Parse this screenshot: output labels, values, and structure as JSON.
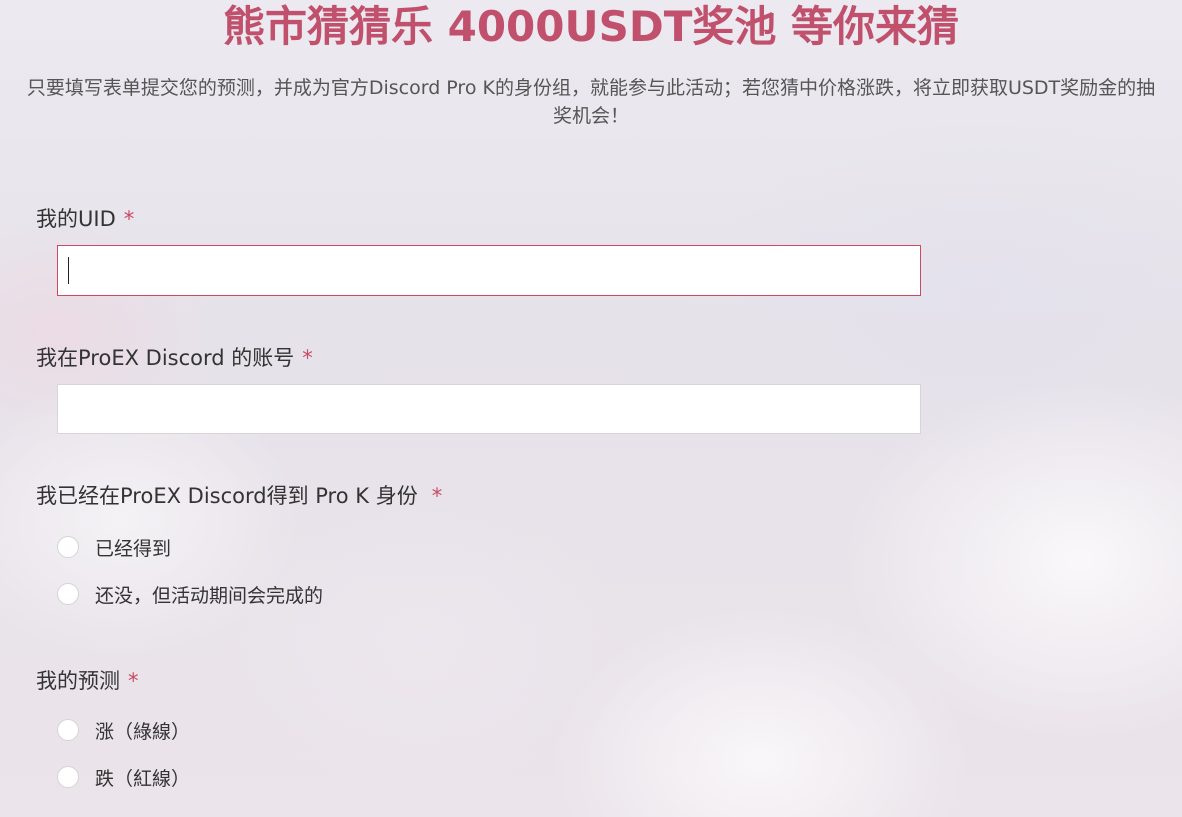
{
  "header": {
    "title": "熊市猜猜乐 4000USDT奖池 等你来猜",
    "subtitle": "只要填写表单提交您的预测，并成为官方Discord Pro K的身份组，就能参与此活动；若您猜中价格涨跌，将立即获取USDT奖励金的抽奖机会！"
  },
  "colors": {
    "accent": "#c0506c",
    "required": "#c94a62"
  },
  "form": {
    "uid": {
      "label": "我的UID",
      "required_mark": "*",
      "value": ""
    },
    "discord_account": {
      "label": "我在ProEX Discord 的账号",
      "required_mark": "*",
      "value": ""
    },
    "pro_k_role": {
      "label": "我已经在ProEX Discord得到 Pro K 身份",
      "required_mark": "*",
      "options": [
        {
          "label": "已经得到",
          "checked": false
        },
        {
          "label": "还没，但活动期间会完成的",
          "checked": false
        }
      ]
    },
    "prediction": {
      "label": "我的预测",
      "required_mark": "*",
      "options": [
        {
          "label": "涨（綠線）",
          "checked": false
        },
        {
          "label": "跌（紅線）",
          "checked": false
        }
      ]
    }
  }
}
